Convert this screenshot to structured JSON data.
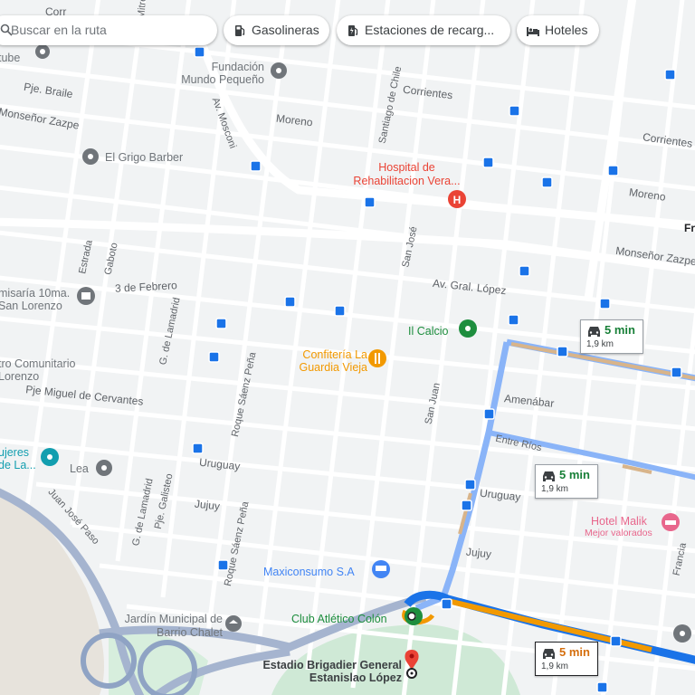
{
  "search": {
    "placeholder": "Buscar en la ruta",
    "icon": "search-icon"
  },
  "chips": [
    {
      "label": "Gasolineras",
      "icon": "gas-station-icon"
    },
    {
      "label": "Estaciones de recarg...",
      "icon": "ev-charger-icon"
    },
    {
      "label": "Hoteles",
      "icon": "bed-icon"
    }
  ],
  "colors": {
    "route_main": "#1a73e8",
    "route_alt": "#8ab4f8",
    "traffic_orange": "#f29900",
    "traffic_slow": "#d8b48a",
    "land": "#f1f3f4",
    "road": "#ffffff",
    "park": "#cfe9d6"
  },
  "routes": [
    {
      "duration": "5 min",
      "distance": "1,9 km",
      "selected": false
    },
    {
      "duration": "5 min",
      "distance": "1,9 km",
      "selected": false
    },
    {
      "duration": "5 min",
      "distance": "1,9 km",
      "selected": true
    }
  ],
  "streets": {
    "corrientes": "Corrientes",
    "corrientes_right": "Corrientes",
    "moreno": "Moreno",
    "moreno_right": "Moreno",
    "mons_zazpe": "Monseñor Zazpe",
    "mons_zazpe_right": "Monseñor Zazpe",
    "pje_braile": "Pje. Braile",
    "santiago": "Santiago de Chile",
    "mosconi": "Av. Mosconi",
    "gral_lopez": "Av. Gral. López",
    "san_jose": "San José",
    "febrero": "3 de Febrero",
    "estrada": "Estrada",
    "gaboto": "Gaboto",
    "lamadrid": "G. de Lamadrid",
    "lamadrid2": "G. de Lamadrid",
    "cervantes": "Pje Miguel de Cervantes",
    "amenabar": "Amenábar",
    "entre_rios": "Entre Ríos",
    "uruguay_left": "Uruguay",
    "uruguay_right": "Uruguay",
    "jujuy_left": "Jujuy",
    "jujuy_right": "Jujuy",
    "saenz_pena": "Roque Sáenz Peña",
    "saenz_pena2": "Roque Sáenz Peña",
    "san_juan": "San Juan",
    "galisteo": "Pje. Galisteo",
    "juan_jose_paso": "Juan José Paso",
    "francia": "Francia",
    "mitre": "Mitre",
    "fr": "Fr",
    "corr_top": "Corr"
  },
  "pois": {
    "fundacion": "Fundación Mundo Pequeño",
    "grigo": "El Grigo Barber",
    "hospital": "Hospital de Rehabilitacion Vera...",
    "comisaria": "misaría 10ma. San Lorenzo",
    "calcio": "Il Calcio",
    "confiteria": "Confitería La Guardia Vieja",
    "centro": "tro Comunitario Lorenzo",
    "mujeres": "ujeres de La...",
    "lea": "Lea",
    "maxiconsumo": "Maxiconsumo S.A",
    "jardin": "Jardín Municipal de Barrio Chalet",
    "club": "Club Atlético Colón",
    "estadio": "Estadio Brigadier General Estanislao López",
    "hotel": "Hotel Malik",
    "hotel_sub": "Mejor valorados",
    "tube": "tube"
  }
}
